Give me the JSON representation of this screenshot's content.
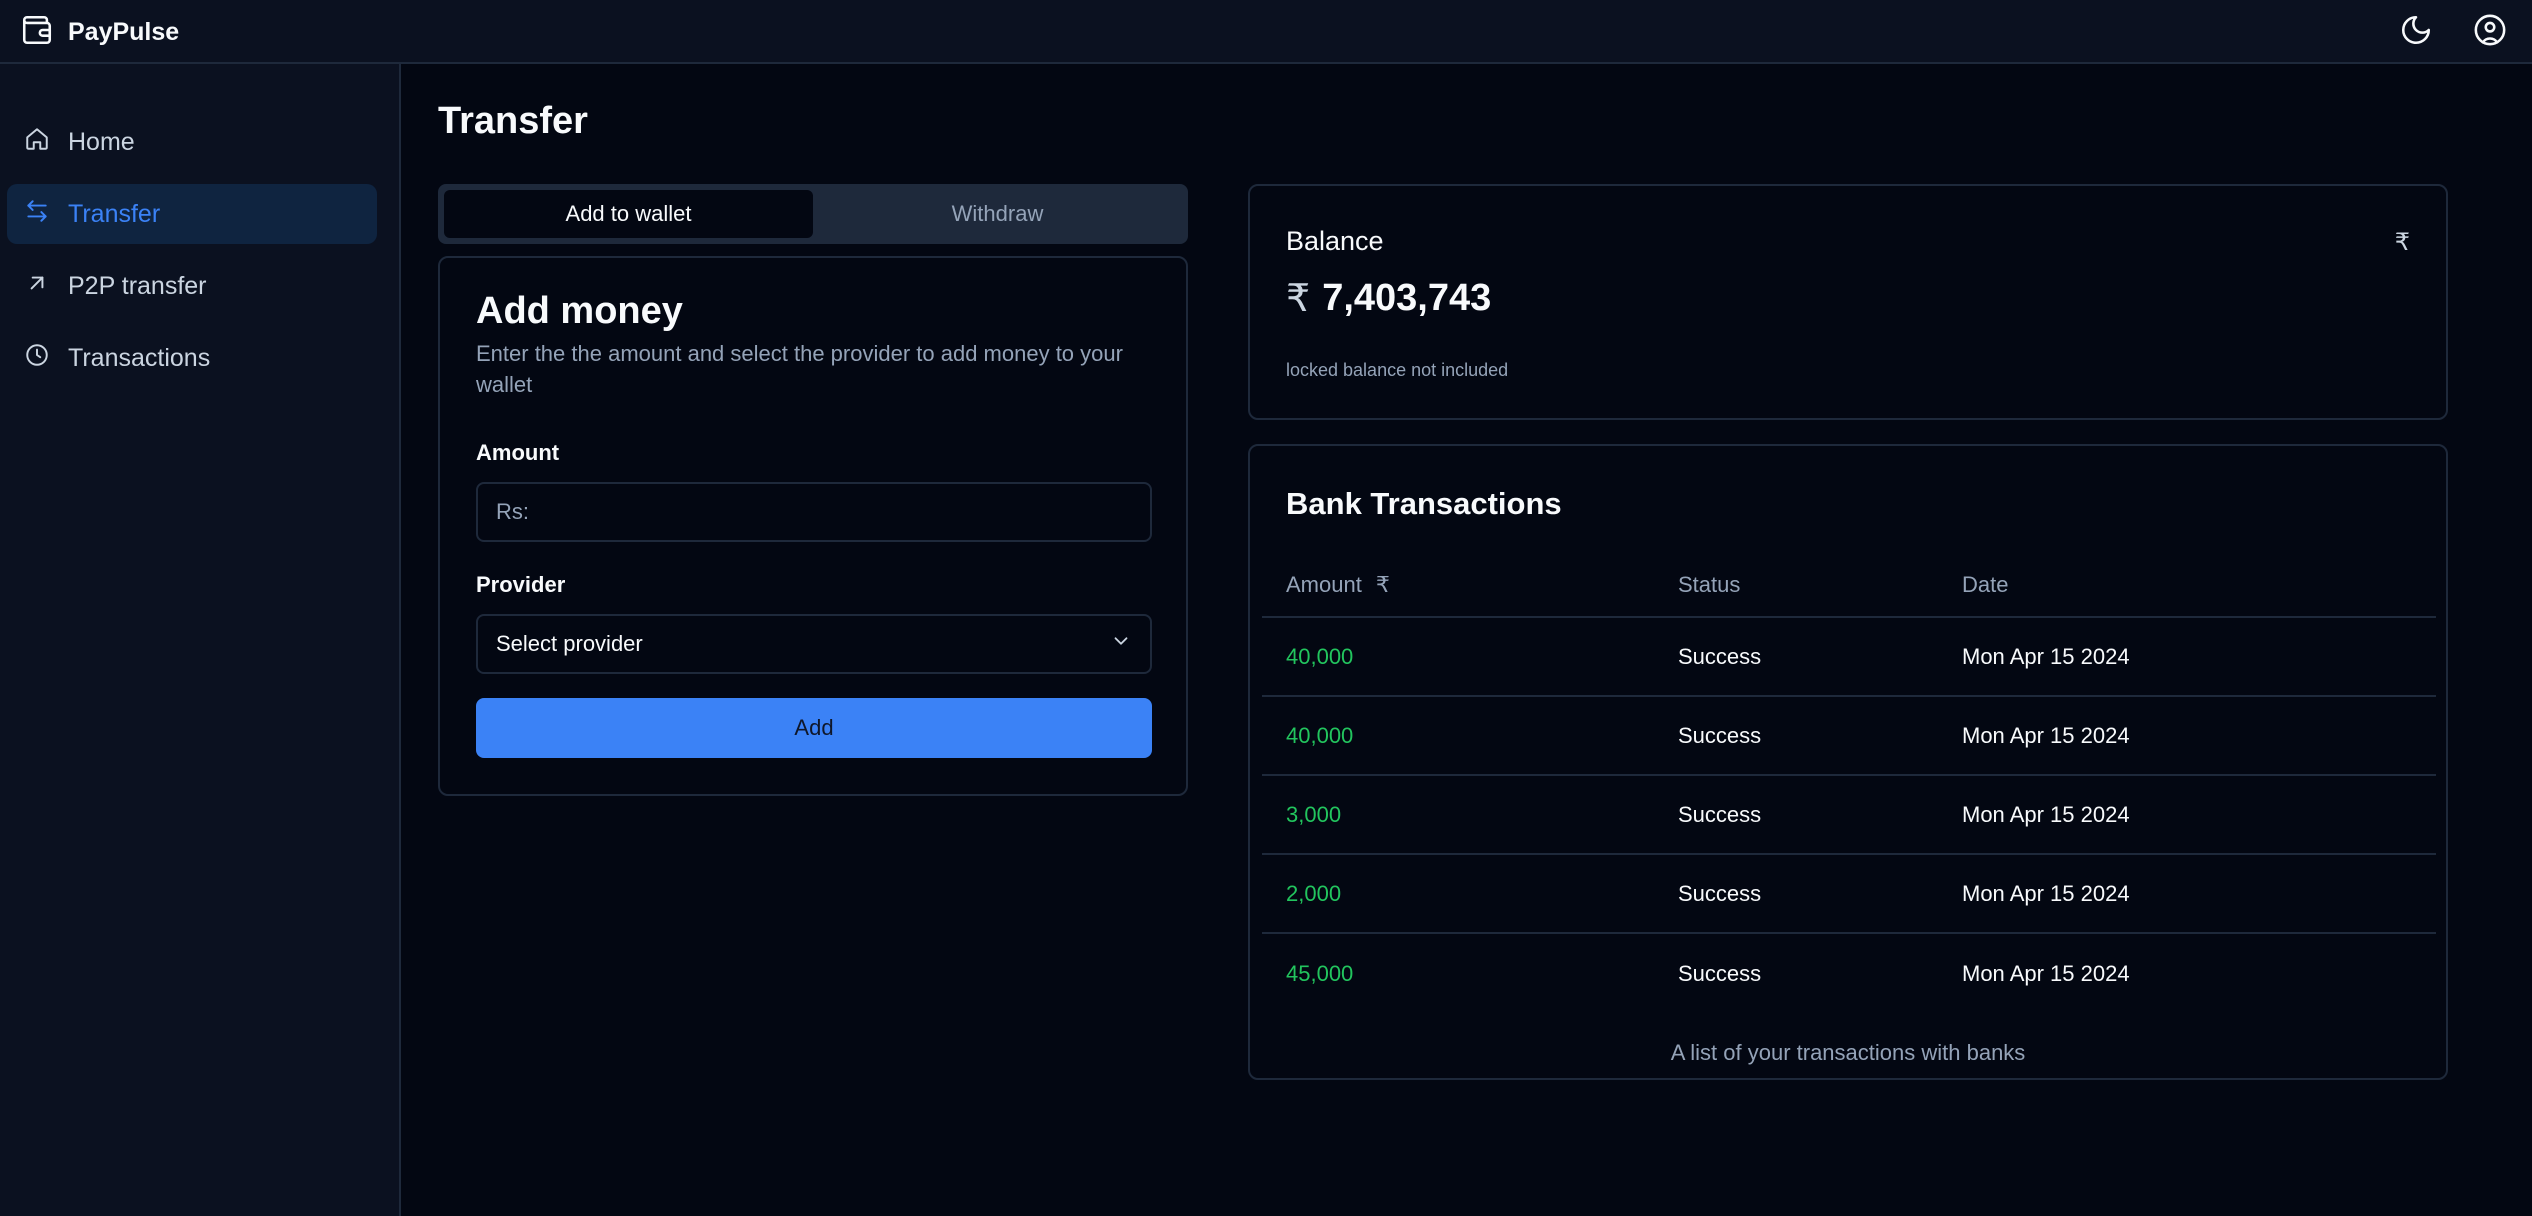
{
  "app": {
    "name": "PayPulse"
  },
  "header": {
    "theme_icon": "moon-icon",
    "account_icon": "user-circle-icon"
  },
  "sidebar": {
    "items": [
      {
        "label": "Home",
        "icon": "home-icon"
      },
      {
        "label": "Transfer",
        "icon": "arrows-left-right-icon",
        "active": true
      },
      {
        "label": "P2P transfer",
        "icon": "arrow-up-right-icon"
      },
      {
        "label": "Transactions",
        "icon": "clock-icon"
      }
    ]
  },
  "page": {
    "title": "Transfer"
  },
  "tabs": [
    {
      "label": "Add to wallet",
      "active": true
    },
    {
      "label": "Withdraw",
      "active": false
    }
  ],
  "add_money": {
    "title": "Add money",
    "description": "Enter the the amount and select the provider to add money to your wallet",
    "amount_label": "Amount",
    "amount_placeholder": "Rs:",
    "provider_label": "Provider",
    "provider_selected": "Select provider",
    "submit_label": "Add"
  },
  "balance": {
    "title": "Balance",
    "currency_symbol": "₹",
    "amount": "7,403,743",
    "note": "locked balance not included"
  },
  "bank_transactions": {
    "title": "Bank Transactions",
    "columns": {
      "amount": "Amount",
      "amount_symbol": "₹",
      "status": "Status",
      "date": "Date"
    },
    "rows": [
      {
        "amount": "40,000",
        "status": "Success",
        "date": "Mon Apr 15 2024"
      },
      {
        "amount": "40,000",
        "status": "Success",
        "date": "Mon Apr 15 2024"
      },
      {
        "amount": "3,000",
        "status": "Success",
        "date": "Mon Apr 15 2024"
      },
      {
        "amount": "2,000",
        "status": "Success",
        "date": "Mon Apr 15 2024"
      },
      {
        "amount": "45,000",
        "status": "Success",
        "date": "Mon Apr 15 2024"
      }
    ],
    "caption": "A list of your transactions with banks"
  },
  "colors": {
    "background": "#030712",
    "sidebar": "#0b1120",
    "accent": "#3b82f6",
    "positive": "#22c55e",
    "border": "#1e293b"
  }
}
